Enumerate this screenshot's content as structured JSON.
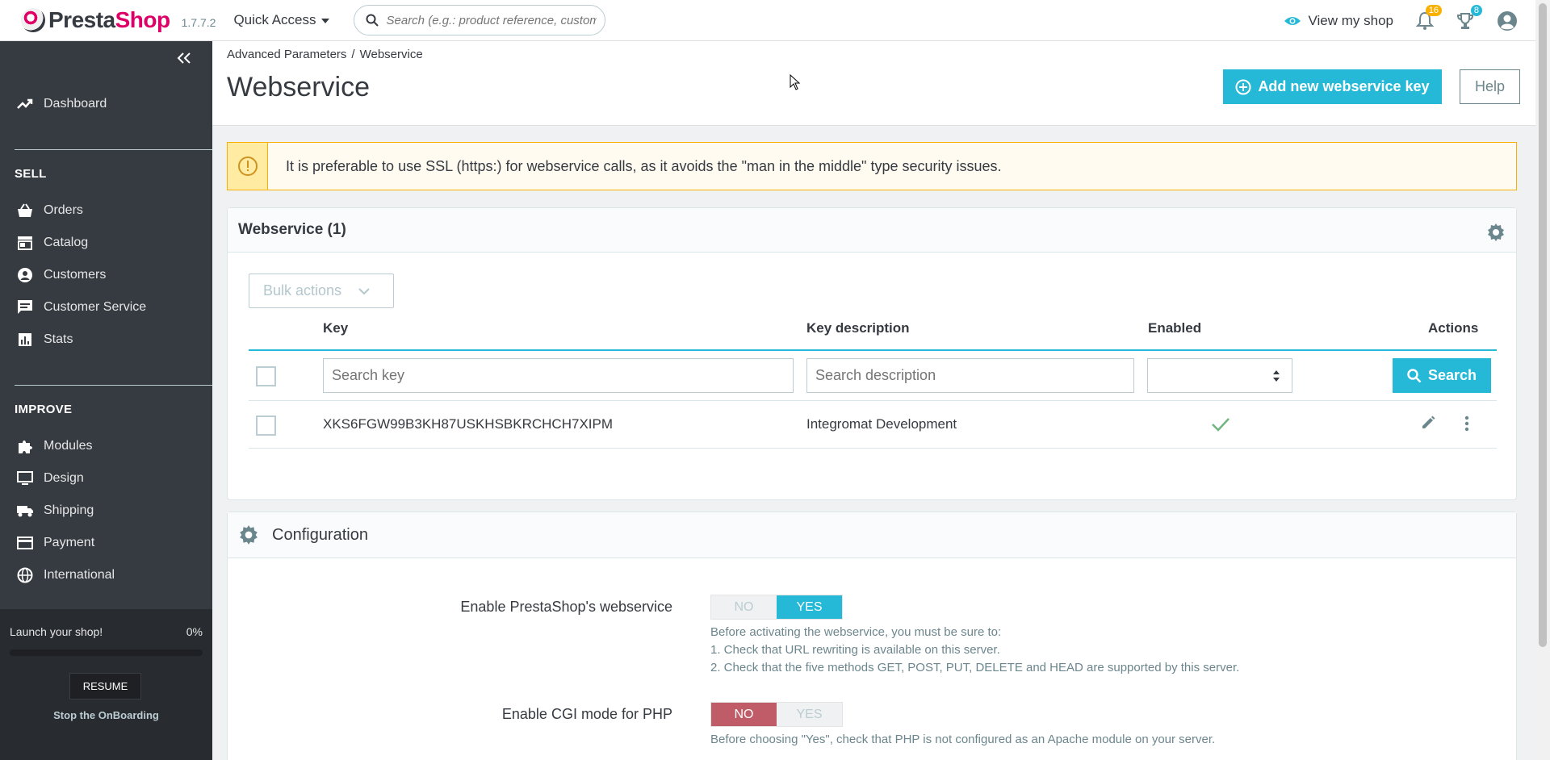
{
  "header": {
    "logo_presta": "Presta",
    "logo_shop": "Shop",
    "version": "1.7.7.2",
    "quick_access": "Quick Access",
    "search_placeholder": "Search (e.g.: product reference, custome",
    "view_shop": "View my shop",
    "notif_count": "16",
    "orders_count": "8"
  },
  "sidebar": {
    "dashboard": "Dashboard",
    "sell_title": "SELL",
    "sell_items": [
      "Orders",
      "Catalog",
      "Customers",
      "Customer Service",
      "Stats"
    ],
    "improve_title": "IMPROVE",
    "improve_items": [
      "Modules",
      "Design",
      "Shipping",
      "Payment",
      "International"
    ],
    "onboarding": {
      "launch": "Launch your shop!",
      "percent": "0%",
      "resume": "RESUME",
      "stop": "Stop the OnBoarding"
    }
  },
  "page": {
    "breadcrumb_parent": "Advanced Parameters",
    "breadcrumb_sep": "/",
    "breadcrumb_current": "Webservice",
    "title": "Webservice",
    "add_button": "Add new webservice key",
    "help_button": "Help"
  },
  "alert": {
    "text": "It is preferable to use SSL (https:) for webservice calls, as it avoids the \"man in the middle\" type security issues."
  },
  "list": {
    "title": "Webservice (1)",
    "bulk_actions": "Bulk actions",
    "columns": [
      "Key",
      "Key description",
      "Enabled",
      "Actions"
    ],
    "search_key_placeholder": "Search key",
    "search_desc_placeholder": "Search description",
    "search_button": "Search",
    "rows": [
      {
        "key": "XKS6FGW99B3KH87USKHSBKRCHCH7XIPM",
        "description": "Integromat Development",
        "enabled": true
      }
    ]
  },
  "config": {
    "title": "Configuration",
    "webservice_label": "Enable PrestaShop's webservice",
    "webservice_no": "NO",
    "webservice_yes": "YES",
    "webservice_help": [
      "Before activating the webservice, you must be sure to:",
      "1. Check that URL rewriting is available on this server.",
      "2. Check that the five methods GET, POST, PUT, DELETE and HEAD are supported by this server."
    ],
    "cgi_label": "Enable CGI mode for PHP",
    "cgi_no": "NO",
    "cgi_yes": "YES",
    "cgi_help": "Before choosing \"Yes\", check that PHP is not configured as an Apache module on your server."
  },
  "colors": {
    "primary": "#25b9d7",
    "sidebar": "#363a41",
    "danger": "#c05c67",
    "warning": "#fab000",
    "success": "#70b580"
  }
}
